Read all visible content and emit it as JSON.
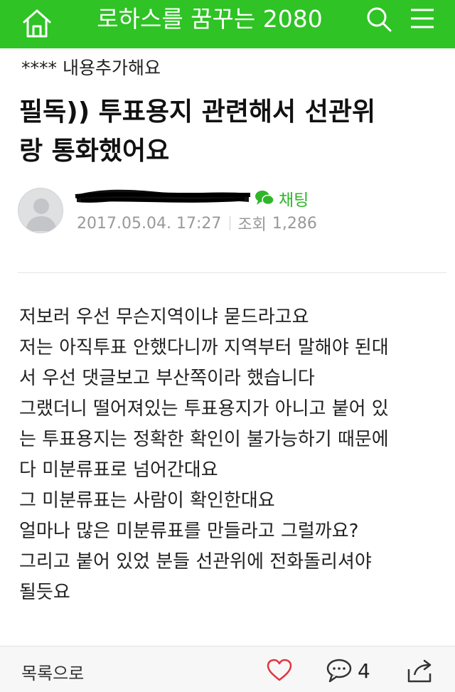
{
  "header": {
    "title": "로하스를 꿈꾸는 2080",
    "home_icon": "home-icon",
    "search_icon": "search-icon",
    "menu_icon": "menu-icon",
    "bg_color": "#2fc325"
  },
  "notice": "**** 내용추가해요",
  "post": {
    "title_lines": [
      "필독)) 투표용지 관련해서 선관위",
      "랑 통화했어요"
    ],
    "chat_label": "채팅",
    "date": "2017.05.04. 17:27",
    "views_label": "조회",
    "views": "1,286",
    "body_lines": [
      "저보러 우선 무슨지역이냐 묻드라고요",
      "저는 아직투표 안했다니까 지역부터 말해야 된대",
      "서 우선 댓글보고 부산쪽이라 했습니다",
      "그랬더니 떨어져있는 투표용지가  아니고 붙어 있",
      "는 투표용지는 정확한 확인이 불가능하기  때문에",
      "다 미분류표로 넘어간대요",
      "그 미분류표는 사람이 확인한대요",
      "얼마나 많은 미분류표를 만들라고 그럴까요?",
      "그리고 붙어 있었 분들  선관위에  전화돌리셔야",
      "될듯요"
    ]
  },
  "bottombar": {
    "list_label": "목록으로",
    "comment_count": "4",
    "heart_icon": "heart-icon",
    "comment_icon": "comment-icon",
    "share_icon": "share-icon",
    "heart_color": "#e0373f"
  }
}
